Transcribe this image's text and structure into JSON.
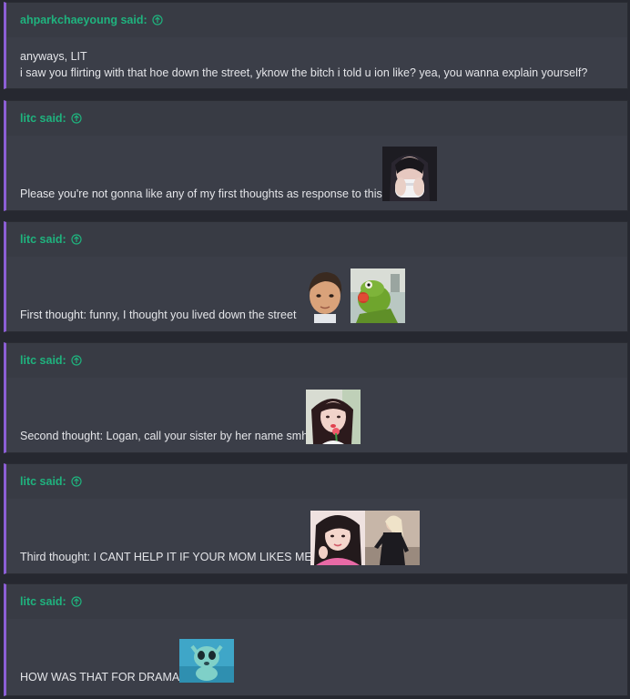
{
  "posts": [
    {
      "author": "ahparkchaeyoung",
      "said_label": " said:",
      "lines": [
        "anyways, LIT",
        "i saw you flirting with that hoe down the street, yknow the bitch i told u ion like? yea, you wanna explain yourself?"
      ]
    },
    {
      "author": "litc",
      "said_label": " said:",
      "text": "Please you're not gonna like any of my first thoughts as response to this",
      "images": [
        "woman-covering-mouth-photo"
      ]
    },
    {
      "author": "litc",
      "said_label": " said:",
      "text": "First thought: funny, I thought you lived down the street",
      "images": [
        "young-man-face-photo",
        "kermit-sipping-tea-photo"
      ]
    },
    {
      "author": "litc",
      "said_label": " said:",
      "text": "Second thought: Logan, call your sister by her name smh",
      "images": [
        "girl-with-flower-photo"
      ]
    },
    {
      "author": "litc",
      "said_label": " said:",
      "text": "Third thought: I CANT HELP IT IF YOUR MOM LIKES ME",
      "images": [
        "woman-in-pink-photo",
        "woman-in-black-outfit-photo"
      ]
    },
    {
      "author": "litc",
      "said_label": " said:",
      "text": "HOW WAS THAT FOR DRAMA",
      "images": [
        "alien-baby-meme-photo"
      ]
    }
  ],
  "colors": {
    "background": "#262830",
    "quote_bg": "#373a43",
    "accent_border": "#8c5fd6",
    "author_green": "#1fb37e",
    "text": "#e4e5e9"
  }
}
